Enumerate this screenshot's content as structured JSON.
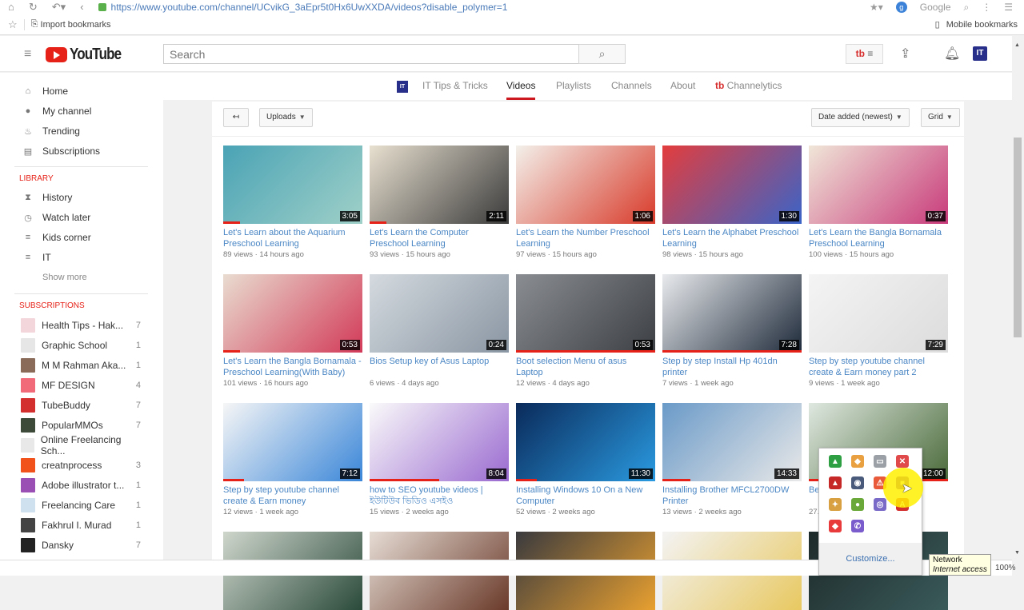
{
  "browser": {
    "url": "https://www.youtube.com/channel/UCvikG_3aEpr5t0Hx6UwXXDA/videos?disable_polymer=1",
    "search_engine": "Google",
    "bookmarks": {
      "import_label": "Import bookmarks",
      "mobile_label": "Mobile bookmarks"
    },
    "zoom": "100%"
  },
  "header": {
    "logo_text": "YouTube",
    "search_placeholder": "Search",
    "tubebuddy_label": "tb",
    "avatar_label": "IT"
  },
  "sidebar": {
    "main": [
      {
        "label": "Home",
        "icon": "home-icon",
        "glyph": "⌂"
      },
      {
        "label": "My channel",
        "icon": "account-icon",
        "glyph": "●"
      },
      {
        "label": "Trending",
        "icon": "flame-icon",
        "glyph": "♨"
      },
      {
        "label": "Subscriptions",
        "icon": "subscriptions-icon",
        "glyph": "▤"
      }
    ],
    "library_heading": "LIBRARY",
    "library": [
      {
        "label": "History",
        "icon": "hourglass-icon",
        "glyph": "⧗"
      },
      {
        "label": "Watch later",
        "icon": "clock-icon",
        "glyph": "◷"
      },
      {
        "label": "Kids corner",
        "icon": "playlist-icon",
        "glyph": "≡"
      },
      {
        "label": "IT",
        "icon": "playlist-icon",
        "glyph": "≡"
      }
    ],
    "show_more": "Show more",
    "subscriptions_heading": "SUBSCRIPTIONS",
    "subscriptions": [
      {
        "label": "Health Tips - Hak...",
        "count": "7",
        "color": "#f3d6dc"
      },
      {
        "label": "Graphic School",
        "count": "1",
        "color": "#e6e6e6"
      },
      {
        "label": "M M Rahman Aka...",
        "count": "1",
        "color": "#8a6a58"
      },
      {
        "label": "MF DESIGN",
        "count": "4",
        "color": "#f06a7a"
      },
      {
        "label": "TubeBuddy",
        "count": "7",
        "color": "#d32f2f"
      },
      {
        "label": "PopularMMOs",
        "count": "7",
        "color": "#3d4a3a"
      },
      {
        "label": "Online Freelancing Sch...",
        "count": "",
        "color": "#e8e8e8"
      },
      {
        "label": "creatnprocess",
        "count": "3",
        "color": "#f1511b"
      },
      {
        "label": "Adobe illustrator t...",
        "count": "1",
        "color": "#9a4fb5"
      },
      {
        "label": "Freelancing Care",
        "count": "1",
        "color": "#cfe0ef"
      },
      {
        "label": "Fakhrul I. Murad",
        "count": "1",
        "color": "#444"
      },
      {
        "label": "Dansky",
        "count": "7",
        "color": "#222"
      }
    ]
  },
  "channel_tabs": {
    "channel_name": "IT Tips & Tricks",
    "tabs": [
      "Videos",
      "Playlists",
      "Channels",
      "About"
    ],
    "active_tab": "Videos",
    "channelytics": "Channelytics"
  },
  "toolbar": {
    "back_label": "↤",
    "uploads_label": "Uploads",
    "sort_label": "Date added (newest)",
    "view_label": "Grid"
  },
  "videos": [
    {
      "title": "Let's Learn about the Aquarium Preschool Learning",
      "views": "89 views",
      "age": "14 hours ago",
      "duration": "3:05",
      "progress": 0.12,
      "thumb": [
        "#4aa3b5",
        "#9fd0c8"
      ]
    },
    {
      "title": "Let's Learn the Computer Preschool Learning",
      "views": "93 views",
      "age": "15 hours ago",
      "duration": "2:11",
      "progress": 0.12,
      "thumb": [
        "#e8e0d0",
        "#3b3b3b"
      ]
    },
    {
      "title": "Let's Learn the Number Preschool Learning",
      "views": "97 views",
      "age": "15 hours ago",
      "duration": "1:06",
      "progress": 0,
      "thumb": [
        "#f3f0ea",
        "#d83a2a"
      ]
    },
    {
      "title": "Let's Learn the Alphabet Preschool Learning",
      "views": "98 views",
      "age": "15 hours ago",
      "duration": "1:30",
      "progress": 0,
      "thumb": [
        "#e33d3d",
        "#3a64c8"
      ]
    },
    {
      "title": "Let's Learn the Bangla Bornamala Preschool Learning",
      "views": "100 views",
      "age": "15 hours ago",
      "duration": "0:37",
      "progress": 0,
      "thumb": [
        "#f0e6d8",
        "#c83a7a"
      ]
    },
    {
      "title": "Let's Learn the Bangla Bornamala - Preschool Learning(With Baby)",
      "views": "101 views",
      "age": "16 hours ago",
      "duration": "0:53",
      "progress": 0.12,
      "thumb": [
        "#e9dcd0",
        "#d23a58"
      ]
    },
    {
      "title": "Bios Setup key of Asus Laptop",
      "views": "6 views",
      "age": "4 days ago",
      "duration": "0:24",
      "progress": 0,
      "thumb": [
        "#d4dadf",
        "#8a96a3"
      ]
    },
    {
      "title": "Boot selection Menu of asus Laptop",
      "views": "12 views",
      "age": "4 days ago",
      "duration": "0:53",
      "progress": 1.0,
      "thumb": [
        "#8a8d92",
        "#3c3f44"
      ]
    },
    {
      "title": "Step by step Install Hp 401dn printer",
      "views": "7 views",
      "age": "1 week ago",
      "duration": "7:28",
      "progress": 1.0,
      "thumb": [
        "#e8eaed",
        "#1e2a3a"
      ]
    },
    {
      "title": "Step by step youtube channel create & Earn money part 2",
      "views": "9 views",
      "age": "1 week ago",
      "duration": "7:29",
      "progress": 0,
      "thumb": [
        "#f4f4f4",
        "#dcdcdc"
      ]
    },
    {
      "title": "Step by step youtube channel create & Earn money",
      "views": "12 views",
      "age": "1 week ago",
      "duration": "7:12",
      "progress": 0.15,
      "thumb": [
        "#f6f6f6",
        "#3a86d8"
      ]
    },
    {
      "title": "how to SEO youtube videos | ইউটিউব ভিডিও এসইও",
      "views": "15 views",
      "age": "2 weeks ago",
      "duration": "8:04",
      "progress": 0.5,
      "thumb": [
        "#fafafa",
        "#9a6ad0"
      ]
    },
    {
      "title": "Installing Windows 10 On a New Computer",
      "views": "52 views",
      "age": "2 weeks ago",
      "duration": "11:30",
      "progress": 0.15,
      "thumb": [
        "#0a2a5a",
        "#2a9ae0"
      ]
    },
    {
      "title": "Installing Brother MFCL2700DW Printer",
      "views": "13 views",
      "age": "2 weeks ago",
      "duration": "14:33",
      "progress": 0.2,
      "thumb": [
        "#6a9ac8",
        "#e8e8e8"
      ]
    },
    {
      "title": "Be... garden, Sr...",
      "views": "27...",
      "age": "",
      "duration": "12:00",
      "progress": 1.0,
      "thumb": [
        "#dfe8e0",
        "#4a6a3a"
      ]
    },
    {
      "title": "",
      "views": "",
      "age": "",
      "duration": "",
      "progress": 0,
      "thumb": [
        "#cfd6cc",
        "#2a4a3a"
      ]
    },
    {
      "title": "",
      "views": "",
      "age": "",
      "duration": "",
      "progress": 0,
      "thumb": [
        "#e6dcd4",
        "#6a3a2a"
      ]
    },
    {
      "title": "",
      "views": "",
      "age": "",
      "duration": "",
      "progress": 0,
      "thumb": [
        "#3a3a3e",
        "#e8a030"
      ]
    },
    {
      "title": "",
      "views": "",
      "age": "",
      "duration": "",
      "progress": 0,
      "thumb": [
        "#f3f3f3",
        "#e8c860"
      ]
    },
    {
      "title": "",
      "views": "",
      "age": "",
      "duration": "",
      "progress": 0,
      "thumb": [
        "#1e2a2a",
        "#3a5a5a"
      ]
    }
  ],
  "tray": {
    "customize_label": "Customize...",
    "icons": [
      {
        "name": "google-drive-icon",
        "color": "#2ea043",
        "glyph": "▲"
      },
      {
        "name": "app-orange-icon",
        "color": "#e8a040",
        "glyph": "◆"
      },
      {
        "name": "printer-icon",
        "color": "#9aa0a6",
        "glyph": "▭"
      },
      {
        "name": "network-error-icon",
        "color": "#e04a4a",
        "glyph": "✕"
      },
      {
        "name": "acrobat-icon",
        "color": "#c62828",
        "glyph": "▲"
      },
      {
        "name": "webcam-icon",
        "color": "#4a5a7a",
        "glyph": "◉"
      },
      {
        "name": "warning-flag-icon",
        "color": "#e85a3a",
        "glyph": "⚠"
      },
      {
        "name": "recorder-icon",
        "color": "#7a3aa8",
        "glyph": "■"
      },
      {
        "name": "satellite-icon",
        "color": "#d8a040",
        "glyph": "✦"
      },
      {
        "name": "app-green-icon",
        "color": "#6aa83a",
        "glyph": "●"
      },
      {
        "name": "torrent-icon",
        "color": "#7a6ac8",
        "glyph": "◎"
      },
      {
        "name": "adobe-icon",
        "color": "#d32f2f",
        "glyph": "A"
      },
      {
        "name": "anydesk-icon",
        "color": "#e83a3a",
        "glyph": "◆"
      },
      {
        "name": "viber-icon",
        "color": "#7b5ccc",
        "glyph": "✆"
      }
    ]
  },
  "tooltip": {
    "title": "Network",
    "subtitle": "Internet access"
  }
}
